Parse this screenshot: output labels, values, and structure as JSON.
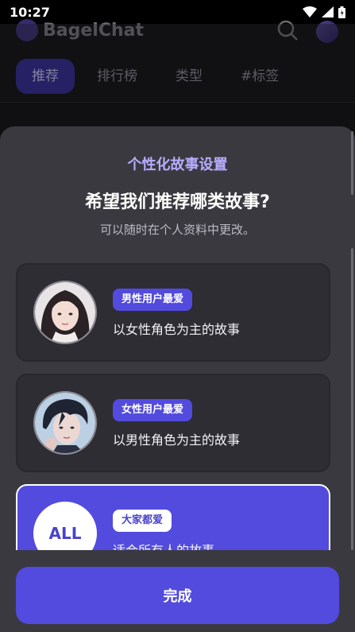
{
  "status_bar": {
    "time": "10:27",
    "icons": [
      "wifi-icon",
      "signal-icon",
      "battery-icon"
    ]
  },
  "header": {
    "logo_text": "BagelChat",
    "tabs": [
      {
        "label": "推荐",
        "active": true
      },
      {
        "label": "排行榜",
        "active": false
      },
      {
        "label": "类型",
        "active": false
      },
      {
        "label": "#标签",
        "active": false
      }
    ]
  },
  "sheet": {
    "subtitle": "个性化故事设置",
    "title": "希望我们推荐哪类故事?",
    "description": "可以随时在个人资料中更改。",
    "options": [
      {
        "badge": "男性用户最爱",
        "text": "以女性角色为主的故事",
        "selected": false
      },
      {
        "badge": "女性用户最爱",
        "text": "以男性角色为主的故事",
        "selected": false
      },
      {
        "badge": "大家都爱",
        "text": "适合所有人的故事",
        "avatar_label": "ALL",
        "selected": true
      }
    ],
    "done_label": "完成"
  },
  "colors": {
    "accent": "#524bde",
    "sheet_bg": "#3a3940",
    "subtitle": "#b7adff"
  }
}
